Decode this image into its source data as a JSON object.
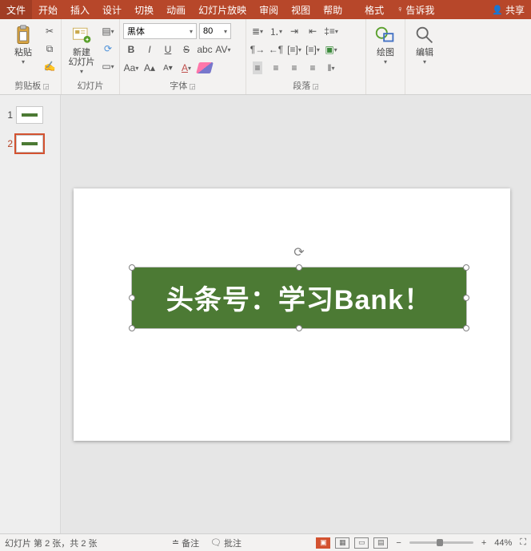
{
  "titlebar": {
    "tabs": {
      "file": "文件",
      "home": "开始",
      "insert": "插入",
      "design": "设计",
      "transitions": "切换",
      "animations": "动画",
      "slideshow": "幻灯片放映",
      "review": "审阅",
      "view": "视图",
      "help": "帮助",
      "format": "格式"
    },
    "tellme": "告诉我",
    "share": "共享"
  },
  "ribbon": {
    "clipboard": {
      "paste": "粘贴",
      "label": "剪贴板"
    },
    "slides": {
      "new_slide": "新建\n幻灯片",
      "label": "幻灯片"
    },
    "font": {
      "family": "黑体",
      "size": "80",
      "label": "字体"
    },
    "paragraph": {
      "label": "段落"
    },
    "drawing": {
      "btn": "绘图",
      "label": ""
    },
    "editing": {
      "btn": "编辑",
      "label": ""
    }
  },
  "thumbs": {
    "s1": "1",
    "s2": "2"
  },
  "slide": {
    "text": "头条号：学习Bank！"
  },
  "status": {
    "slide_of": "幻灯片 第 2 张，共 2 张",
    "notes": "备注",
    "comments": "批注",
    "zoom_minus": "−",
    "zoom_plus": "+",
    "zoom": "44%"
  }
}
